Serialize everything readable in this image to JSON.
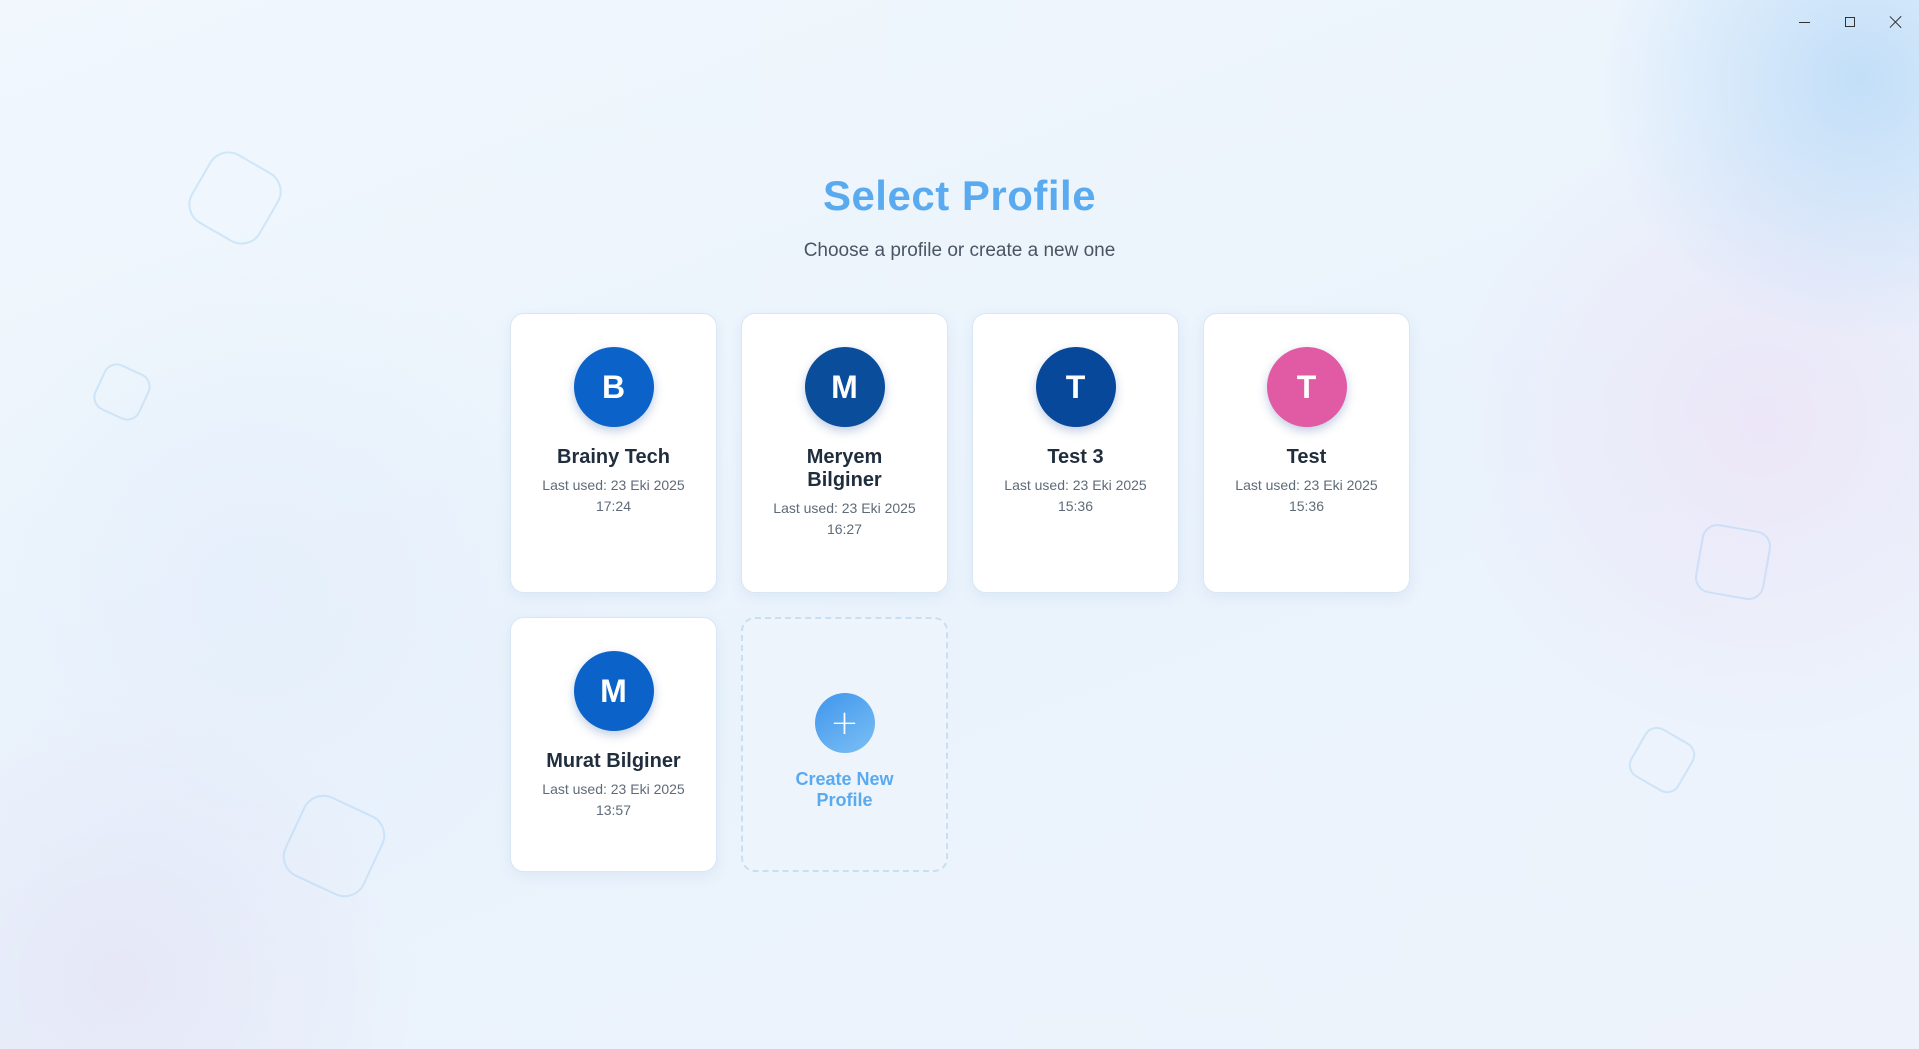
{
  "window": {
    "controls": [
      {
        "name": "minimize",
        "icon": "minimize-icon"
      },
      {
        "name": "maximize",
        "icon": "maximize-icon"
      },
      {
        "name": "close",
        "icon": "close-icon"
      }
    ]
  },
  "header": {
    "title": "Select Profile",
    "subtitle": "Choose a profile or create a new one"
  },
  "profiles": [
    {
      "initial": "B",
      "name": "Brainy Tech",
      "last_used": "Last used: 23 Eki 2025 17:24",
      "color": "#0b63c9"
    },
    {
      "initial": "M",
      "name": "Meryem Bilginer",
      "last_used": "Last used: 23 Eki 2025 16:27",
      "color": "#0a4d9a"
    },
    {
      "initial": "T",
      "name": "Test 3",
      "last_used": "Last used: 23 Eki 2025 15:36",
      "color": "#08489a"
    },
    {
      "initial": "T",
      "name": "Test",
      "last_used": "Last used: 23 Eki 2025 15:36",
      "color": "#e05aa4"
    },
    {
      "initial": "M",
      "name": "Murat Bilginer",
      "last_used": "Last used: 23 Eki 2025 13:57",
      "color": "#0b63c9"
    }
  ],
  "create": {
    "label": "Create New Profile",
    "icon": "plus-icon"
  },
  "colors": {
    "accent": "#5aaaf0",
    "background": "#eef5fc"
  }
}
